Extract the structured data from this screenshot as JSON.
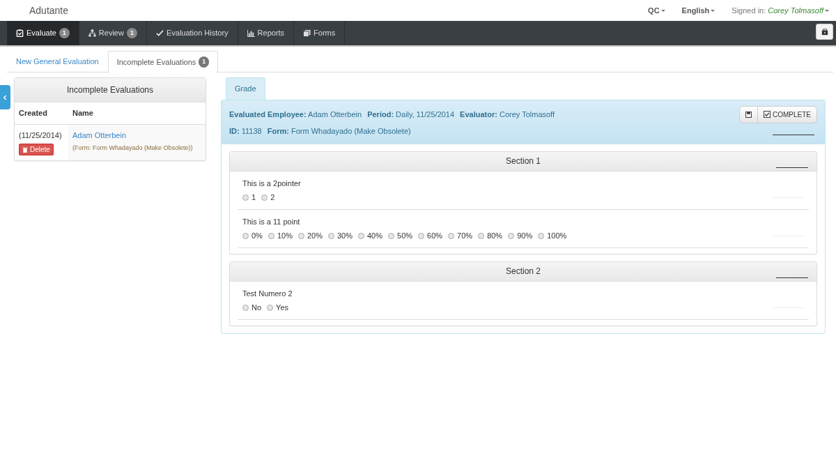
{
  "brand": "Adutante",
  "top_menu": [
    {
      "label": "QC"
    },
    {
      "label": "English"
    }
  ],
  "signed_in": {
    "label": "Signed in:",
    "user": "Corey Tolmasoff"
  },
  "main_nav": [
    {
      "label": "Evaluate",
      "badge": "1",
      "selected": true
    },
    {
      "label": "Review",
      "badge": "1",
      "selected": false
    },
    {
      "label": "Evaluation History",
      "selected": false
    },
    {
      "label": "Reports",
      "selected": false
    },
    {
      "label": "Forms",
      "selected": false
    }
  ],
  "sub_tabs": [
    {
      "label": "New General Evaluation",
      "selected": false
    },
    {
      "label": "Incomplete Evaluations",
      "badge": "1",
      "selected": true
    }
  ],
  "incomplete_panel": {
    "title": "Incomplete Evaluations",
    "columns": [
      "Created",
      "Name"
    ],
    "rows": [
      {
        "created": "(11/25/2014)",
        "delete_label": "Delete",
        "name": "Adam Otterbein",
        "form": "(Form: Form Whadayado (Make Obsolete))"
      }
    ]
  },
  "grade_tabs": [
    {
      "label": "Grade",
      "selected": true
    }
  ],
  "evaluation": {
    "lines": [
      [
        {
          "label": "Evaluated Employee:",
          "value": "Adam Otterbein"
        },
        {
          "label": "Period:",
          "value": "Daily, 11/25/2014"
        },
        {
          "label": "Evaluator:",
          "value": "Corey Tolmasoff"
        }
      ],
      [
        {
          "label": "ID:",
          "value": "11138"
        },
        {
          "label": "Form:",
          "value": "Form Whadayado (Make Obsolete)"
        }
      ]
    ],
    "complete_label": "COMPLETE"
  },
  "sections": [
    {
      "title": "Section 1",
      "questions": [
        {
          "text": "This is a 2pointer",
          "options": [
            {
              "label": "1",
              "selected": false
            },
            {
              "label": "2",
              "selected": false
            }
          ]
        },
        {
          "text": "This is a 11 point",
          "options": [
            {
              "label": "0%",
              "selected": false
            },
            {
              "label": "10%",
              "selected": false
            },
            {
              "label": "20%",
              "selected": false
            },
            {
              "label": "30%",
              "selected": false
            },
            {
              "label": "40%",
              "selected": false
            },
            {
              "label": "50%",
              "selected": false
            },
            {
              "label": "60%",
              "selected": false
            },
            {
              "label": "70%",
              "selected": false
            },
            {
              "label": "80%",
              "selected": false
            },
            {
              "label": "90%",
              "selected": false
            },
            {
              "label": "100%",
              "selected": false
            }
          ]
        }
      ]
    },
    {
      "title": "Section 2",
      "questions": [
        {
          "text": "Test Numero 2",
          "options": [
            {
              "label": "No",
              "selected": false
            },
            {
              "label": "Yes",
              "selected": false
            }
          ]
        }
      ]
    }
  ]
}
